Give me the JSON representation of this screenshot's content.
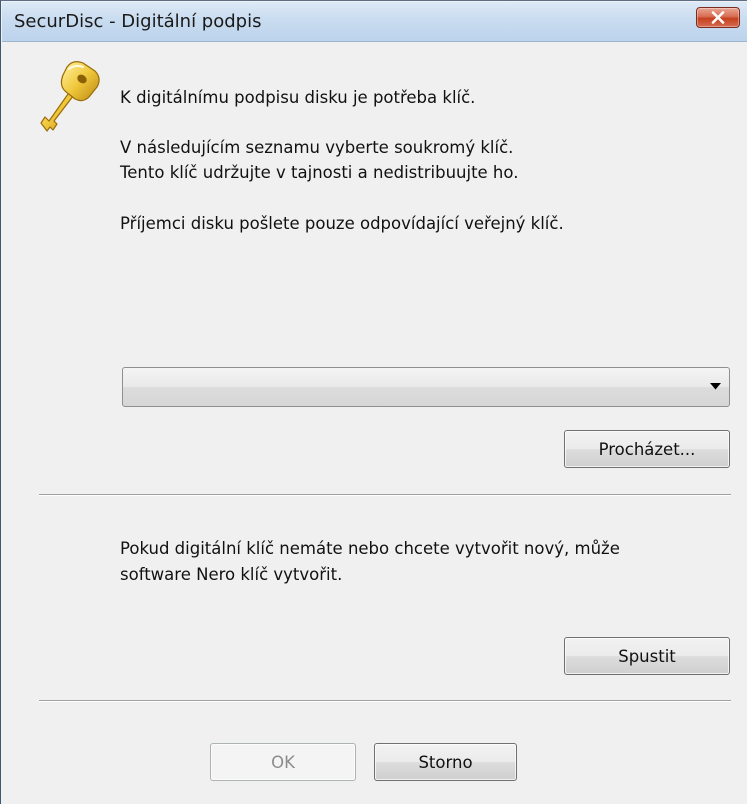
{
  "window": {
    "title": "SecurDisc - Digitální podpis"
  },
  "icons": {
    "key": "key-icon",
    "close": "close-icon",
    "dropdown": "chevron-down-icon"
  },
  "message": {
    "line1": "K digitálnímu podpisu disku je potřeba klíč.",
    "line2": "V následujícím seznamu vyberte soukromý klíč.",
    "line3": "Tento klíč udržujte v tajnosti a nedistribuujte ho.",
    "line4": "Příjemci disku pošlete pouze odpovídající veřejný klíč."
  },
  "key_select": {
    "selected": ""
  },
  "browse_button": {
    "label": "Procházet..."
  },
  "create_section": {
    "line1": "Pokud digitální klíč nemáte nebo chcete vytvořit nový, může",
    "line2": "software Nero klíč vytvořit.",
    "start_label": "Spustit"
  },
  "footer": {
    "ok_label": "OK",
    "cancel_label": "Storno"
  }
}
